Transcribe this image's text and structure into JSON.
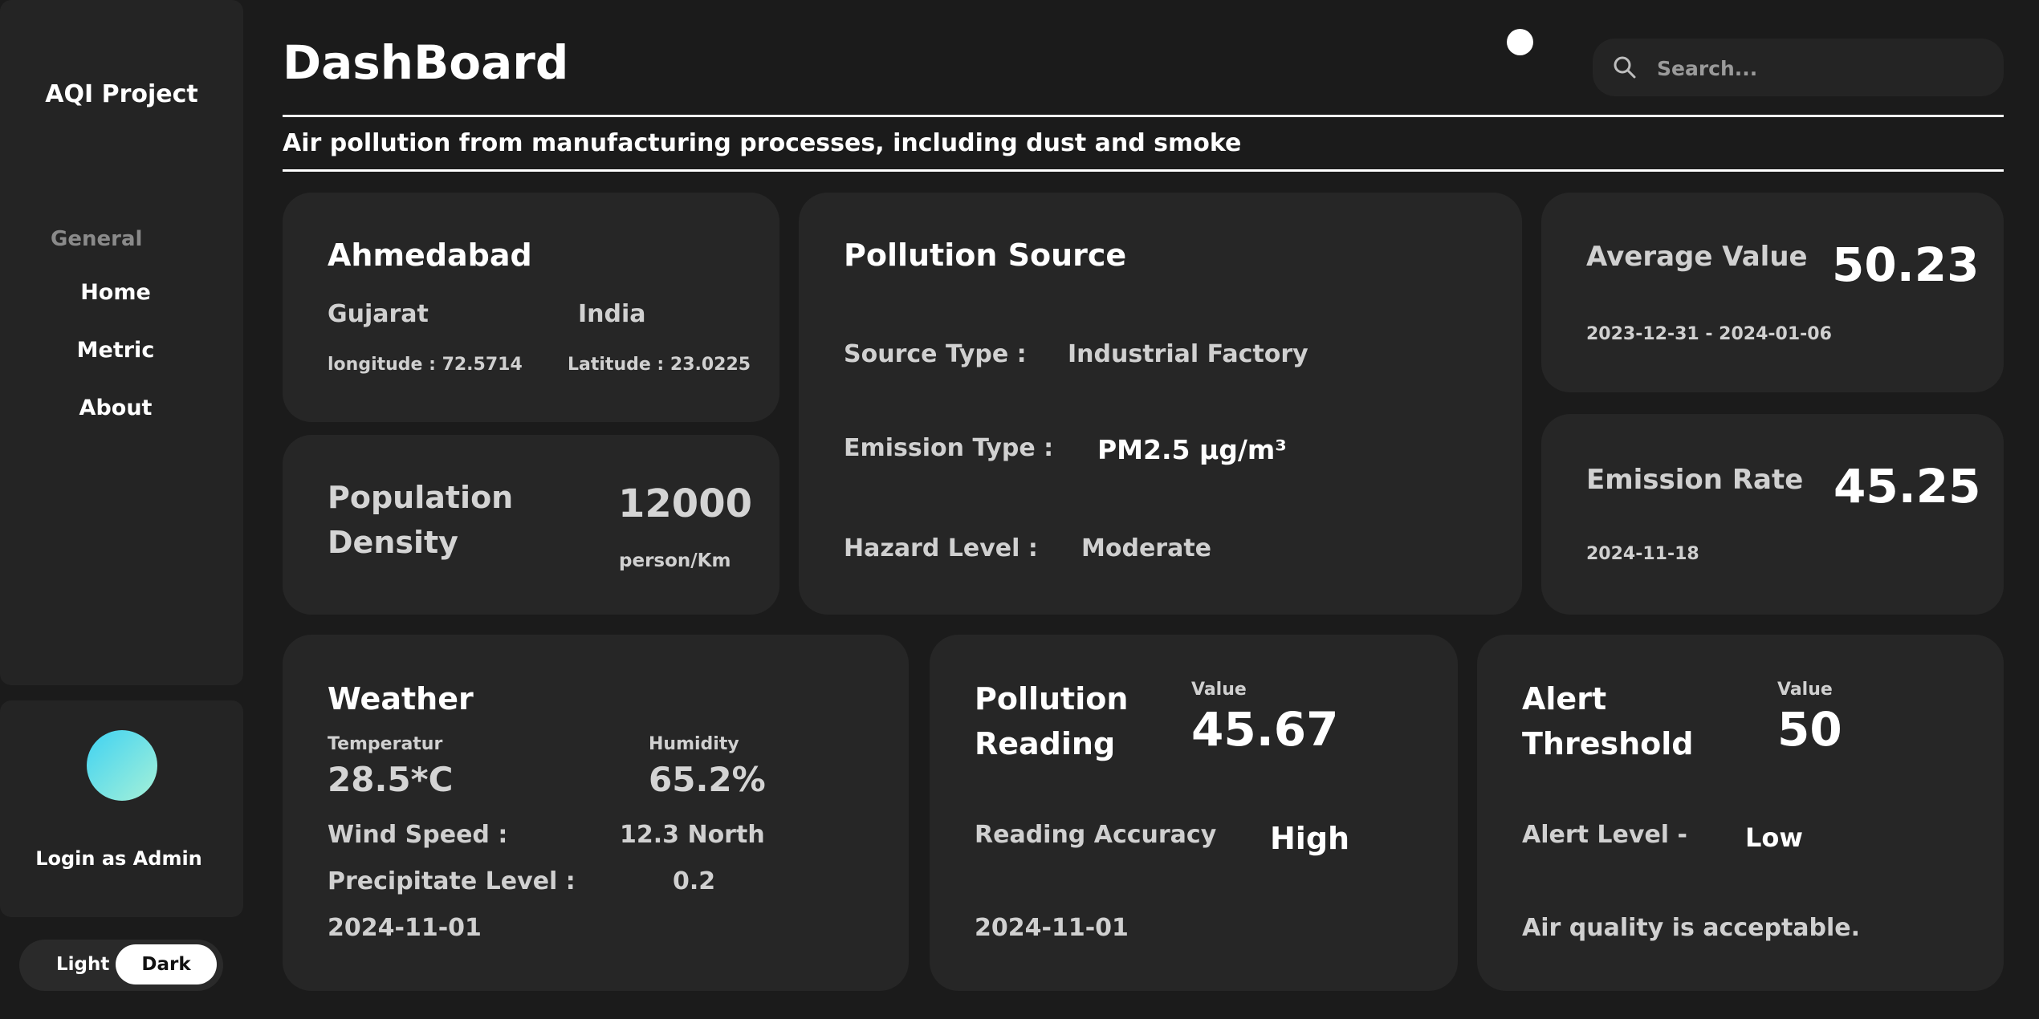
{
  "sidebar": {
    "brand": "AQI Project",
    "section_label": "General",
    "nav": [
      {
        "label": "Home"
      },
      {
        "label": "Metric"
      },
      {
        "label": "About"
      }
    ],
    "user": {
      "login_label": "Login as Admin"
    },
    "theme_toggle": {
      "light_label": "Light",
      "dark_label": "Dark",
      "selected": "Dark"
    }
  },
  "header": {
    "title": "DashBoard",
    "search_placeholder": "Search...",
    "subtitle": "Air pollution from manufacturing processes, including dust and smoke"
  },
  "location": {
    "city": "Ahmedabad",
    "state": "Gujarat",
    "country": "India",
    "longitude": "longitude : 72.5714",
    "latitude": "Latitude : 23.0225"
  },
  "population": {
    "label_line1": "Population",
    "label_line2": "Density",
    "value": "12000",
    "unit": "person/Km"
  },
  "pollution_source": {
    "title": "Pollution Source",
    "source_type_label": "Source Type :",
    "source_type_value": "Industrial Factory",
    "emission_type_label": "Emission Type :",
    "emission_type_value": "PM2.5 µg/m³",
    "hazard_level_label": "Hazard Level :",
    "hazard_level_value": "Moderate"
  },
  "average_value": {
    "label": "Average Value",
    "value": "50.23",
    "date_range": "2023-12-31 - 2024-01-06"
  },
  "emission_rate": {
    "label": "Emission Rate",
    "value": "45.25",
    "date": "2024-11-18"
  },
  "weather": {
    "title": "Weather",
    "temperature_label": "Temperatur",
    "temperature_value": "28.5*C",
    "humidity_label": "Humidity",
    "humidity_value": "65.2%",
    "wind_label": "Wind Speed :",
    "wind_value": "12.3 North",
    "precip_label": "Precipitate Level :",
    "precip_value": "0.2",
    "date": "2024-11-01"
  },
  "pollution_reading": {
    "title_line1": "Pollution",
    "title_line2": "Reading",
    "value_label": "Value",
    "value": "45.67",
    "accuracy_label": "Reading Accuracy",
    "accuracy_value": "High",
    "date": "2024-11-01"
  },
  "alert": {
    "title_line1": "Alert",
    "title_line2": "Threshold",
    "value_label": "Value",
    "value": "50",
    "level_label": "Alert Level -",
    "level_value": "Low",
    "message": "Air quality is acceptable."
  },
  "colors": {
    "background": "#1b1b1b",
    "card": "#262626",
    "sidebar": "#242424",
    "avatar_gradient_start": "#3fd2f2",
    "avatar_gradient_end": "#a6f1d8"
  }
}
